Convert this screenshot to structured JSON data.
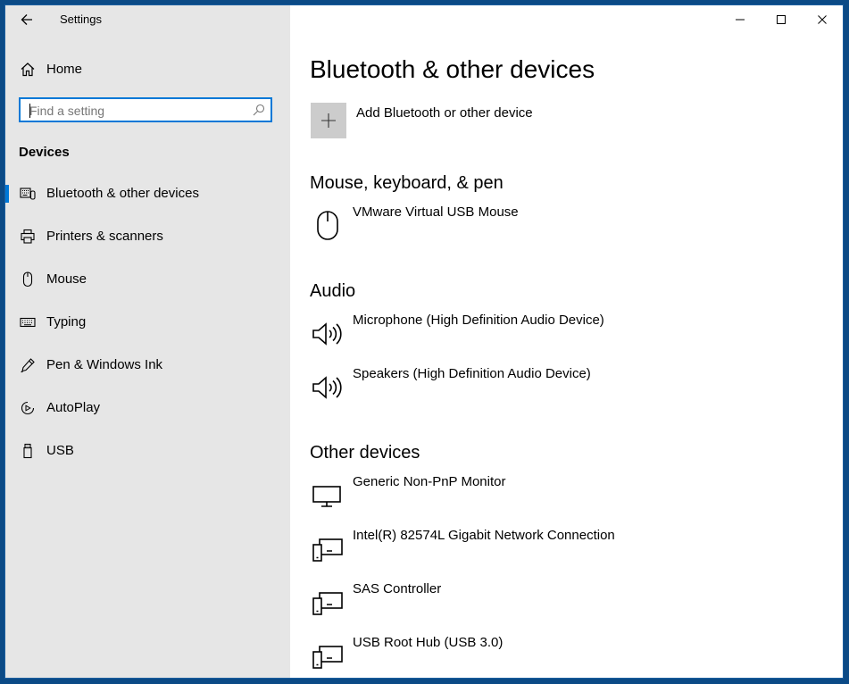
{
  "window": {
    "title": "Settings"
  },
  "sidebar": {
    "home_label": "Home",
    "search_placeholder": "Find a setting",
    "section_title": "Devices",
    "items": [
      {
        "label": "Bluetooth & other devices",
        "icon": "bluetooth-devices-icon",
        "active": true
      },
      {
        "label": "Printers & scanners",
        "icon": "printer-icon"
      },
      {
        "label": "Mouse",
        "icon": "mouse-icon"
      },
      {
        "label": "Typing",
        "icon": "keyboard-icon"
      },
      {
        "label": "Pen & Windows Ink",
        "icon": "pen-icon"
      },
      {
        "label": "AutoPlay",
        "icon": "autoplay-icon"
      },
      {
        "label": "USB",
        "icon": "usb-icon"
      }
    ]
  },
  "main": {
    "title": "Bluetooth & other devices",
    "add_label": "Add Bluetooth or other device",
    "groups": [
      {
        "title": "Mouse, keyboard, & pen",
        "devices": [
          {
            "name": "VMware Virtual USB Mouse",
            "icon": "mouse-icon"
          }
        ]
      },
      {
        "title": "Audio",
        "devices": [
          {
            "name": "Microphone (High Definition Audio Device)",
            "icon": "speaker-icon"
          },
          {
            "name": "Speakers (High Definition Audio Device)",
            "icon": "speaker-icon"
          }
        ]
      },
      {
        "title": "Other devices",
        "devices": [
          {
            "name": "Generic Non-PnP Monitor",
            "icon": "monitor-icon"
          },
          {
            "name": "Intel(R) 82574L Gigabit Network Connection",
            "icon": "device-icon"
          },
          {
            "name": "SAS Controller",
            "icon": "device-icon"
          },
          {
            "name": "USB Root Hub (USB 3.0)",
            "icon": "device-icon"
          }
        ]
      }
    ]
  },
  "colors": {
    "accent": "#0078d7",
    "sidebar_bg": "#e6e6e6",
    "desktop": "#0b4a86"
  }
}
